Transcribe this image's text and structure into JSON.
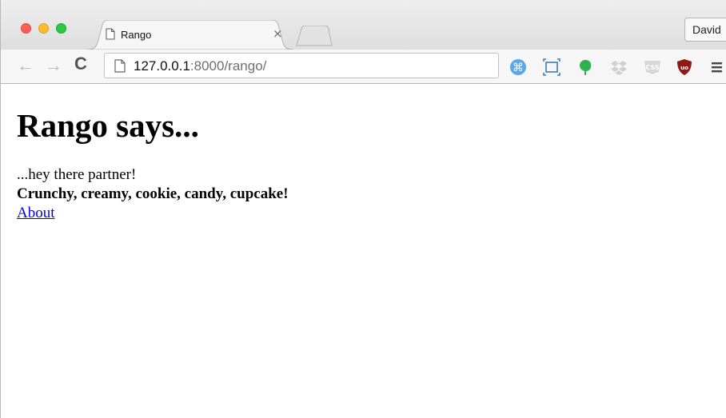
{
  "browser": {
    "tab_title": "Rango",
    "tab_close": "×",
    "profile_name": "David",
    "url_host": "127.0.0.1",
    "url_path": ":8000/rango/"
  },
  "toolbar": {
    "back": "←",
    "forward": "→",
    "reload": "C"
  },
  "extensions": [
    "command-icon",
    "screenshot-frame-icon",
    "evernote-icon",
    "dropbox-icon",
    "css-icon",
    "ublock-icon",
    "menu-icon"
  ],
  "page": {
    "heading": "Rango says...",
    "greeting": "...hey there partner!",
    "tagline": "Crunchy, creamy, cookie, candy, cupcake!",
    "about_link": "About"
  },
  "colors": {
    "link": "#0000ee",
    "close_light": "#fc5f57",
    "minimize_light": "#fdbc2e",
    "maximize_light": "#2ac940"
  }
}
